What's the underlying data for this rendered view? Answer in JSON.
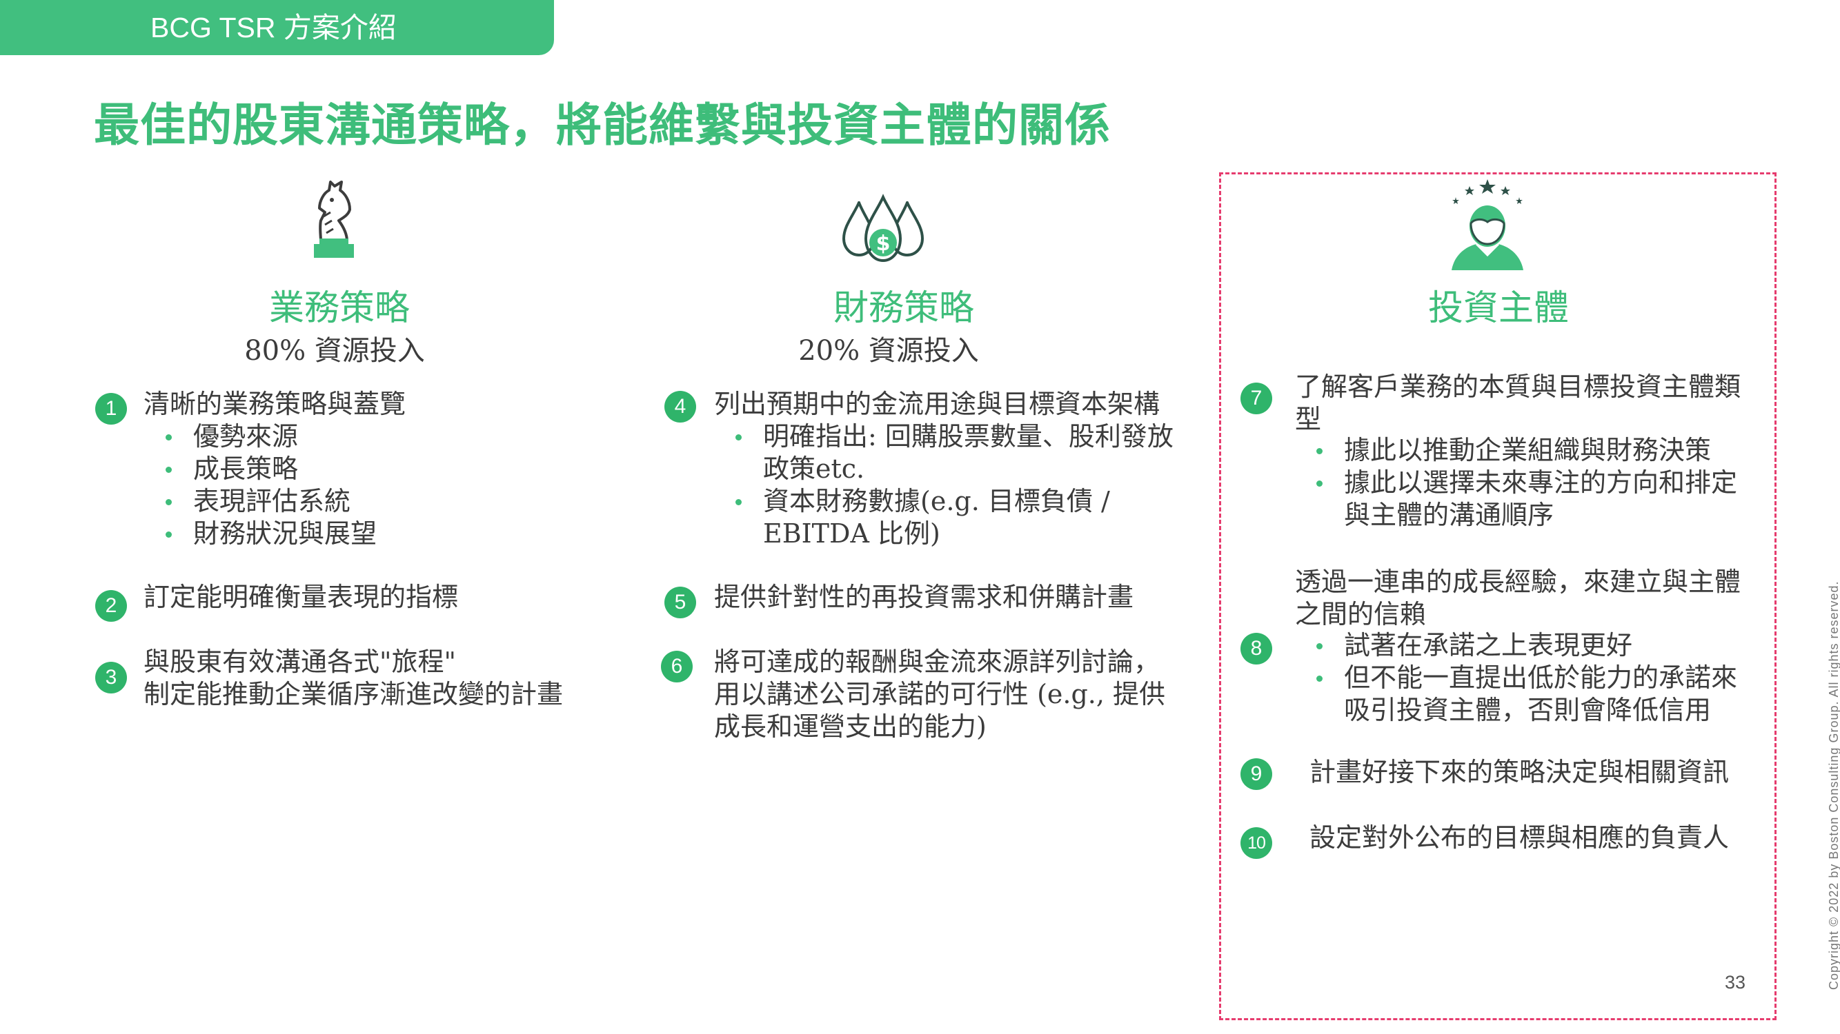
{
  "header": {
    "tag": "BCG TSR 方案介紹",
    "title": "最佳的股東溝通策略，將能維繫與投資主體的關係"
  },
  "colors": {
    "accent": "#3ebd7a",
    "badge": "#2fb46a",
    "highlight_border": "#e63c6e"
  },
  "columns": {
    "business": {
      "icon": "chess-knight-icon",
      "title": "業務策略",
      "subtitle": "80% 資源投入",
      "items": [
        {
          "num": "1",
          "text": "清晰的業務策略與蓋覽",
          "bullets": [
            "優勢來源",
            "成長策略",
            "表現評估系統",
            "財務狀況與展望"
          ]
        },
        {
          "num": "2",
          "text": "訂定能明確衡量表現的指標"
        },
        {
          "num": "3",
          "lines": [
            "與股東有效溝通各式\"旅程\"",
            "制定能推動企業循序漸進改變的計畫"
          ]
        }
      ]
    },
    "finance": {
      "icon": "money-drops-icon",
      "title": "財務策略",
      "subtitle": "20% 資源投入",
      "items": [
        {
          "num": "4",
          "text": "列出預期中的金流用途與目標資本架構",
          "bullets": [
            [
              "明確指出: 回購股票數量、股利發放",
              "政策etc."
            ],
            [
              "資本財務數據(e.g. 目標負債 /",
              "EBITDA 比例)"
            ]
          ]
        },
        {
          "num": "5",
          "text": "提供針對性的再投資需求和併購計畫"
        },
        {
          "num": "6",
          "lines": [
            "將可達成的報酬與金流來源詳列討論，",
            "用以講述公司承諾的可行性 (e.g., 提供",
            "成長和運營支出的能力)"
          ]
        }
      ]
    },
    "investor": {
      "icon": "investor-stars-icon",
      "title": "投資主體",
      "items": [
        {
          "num": "7",
          "lines": [
            "了解客戶業務的本質與目標投資主體類",
            "型"
          ],
          "bullets": [
            [
              "據此以推動企業組織與財務決策"
            ],
            [
              "據此以選擇未來專注的方向和排定",
              "與主體的溝通順序"
            ]
          ]
        },
        {
          "num": "8",
          "lines": [
            "透過一連串的成長經驗，來建立與主體",
            "之間的信賴"
          ],
          "bullets": [
            [
              "試著在承諾之上表現更好"
            ],
            [
              "但不能一直提出低於能力的承諾來",
              "吸引投資主體，否則會降低信用"
            ]
          ]
        },
        {
          "num": "9",
          "text": "計畫好接下來的策略決定與相關資訊"
        },
        {
          "num": "10",
          "text": "設定對外公布的目標與相應的負責人"
        }
      ]
    }
  },
  "footer": {
    "page_number": "33",
    "copyright": "Copyright © 2022 by Boston Consulting Group. All rights reserved."
  }
}
